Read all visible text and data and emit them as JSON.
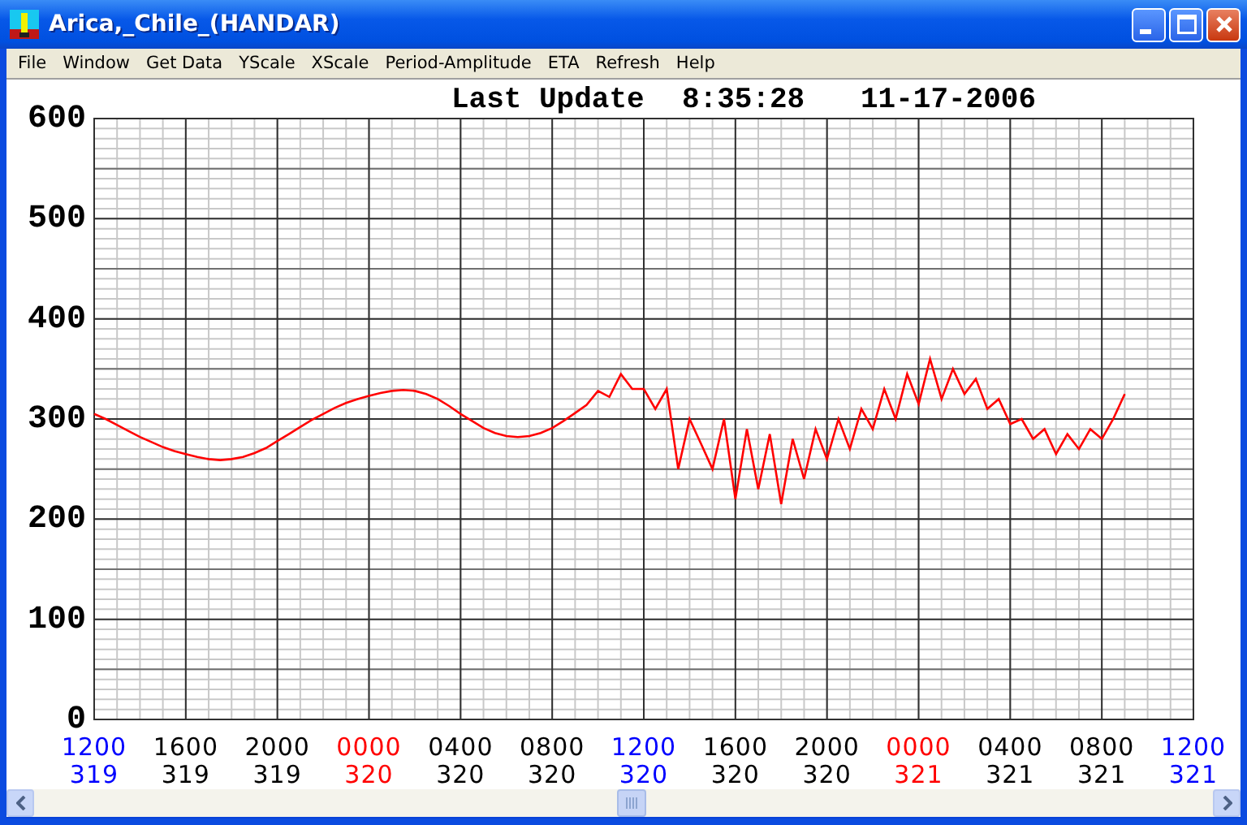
{
  "window": {
    "title": "Arica,_Chile_(HANDAR)"
  },
  "menu": [
    "File",
    "Window",
    "Get Data",
    "YScale",
    "XScale",
    "Period-Amplitude",
    "ETA",
    "Refresh",
    "Help"
  ],
  "header": {
    "label": "Last Update",
    "time": "8:35:28",
    "date": "11-17-2006"
  },
  "chart_data": {
    "type": "line",
    "grid": true,
    "ylim": [
      0,
      600
    ],
    "yticks": [
      0,
      100,
      200,
      300,
      400,
      500,
      600
    ],
    "categories": [
      "1200",
      null,
      null,
      null,
      null,
      null,
      null,
      null,
      "1600",
      null,
      null,
      null,
      null,
      null,
      null,
      null,
      "2000",
      null,
      null,
      null,
      null,
      null,
      null,
      null,
      "0000",
      null,
      null,
      null,
      null,
      null,
      null,
      null,
      "0400",
      null,
      null,
      null,
      null,
      null,
      null,
      null,
      "0800",
      null,
      null,
      null,
      null,
      null,
      null,
      null,
      "1200",
      null,
      null,
      null,
      null,
      null,
      null,
      null,
      "1600",
      null,
      null,
      null,
      null,
      null,
      null,
      null,
      "2000",
      null,
      null,
      null,
      null,
      null,
      null,
      null,
      "0000",
      null,
      null,
      null,
      null,
      null,
      null,
      null,
      "0400",
      null,
      null,
      null,
      null,
      null,
      null,
      null,
      "0800",
      null,
      null,
      null,
      null,
      null,
      null,
      null,
      "1200"
    ],
    "series": [
      {
        "color": "#ff0000",
        "values": [
          305,
          300,
          294,
          288,
          282,
          277,
          272,
          268,
          265,
          262,
          260,
          259,
          260,
          262,
          266,
          271,
          278,
          285,
          292,
          299,
          305,
          311,
          316,
          320,
          323,
          326,
          328,
          329,
          328,
          325,
          320,
          313,
          305,
          298,
          291,
          286,
          283,
          282,
          283,
          286,
          291,
          298,
          306,
          314,
          328,
          322,
          345,
          330,
          330,
          310,
          330,
          250,
          300,
          275,
          250,
          300,
          220,
          290,
          230,
          285,
          215,
          280,
          240,
          290,
          260,
          300,
          270,
          310,
          290,
          330,
          300,
          345,
          315,
          360,
          320,
          350,
          325,
          340,
          310,
          320,
          295,
          300,
          280,
          290,
          265,
          285,
          270,
          290,
          280,
          300,
          325,
          null,
          null,
          null,
          null,
          null,
          null
        ]
      }
    ]
  },
  "x_axis_days": [
    {
      "day": "319",
      "color": "#0000ff"
    },
    {
      "day": "319",
      "color": "#000000"
    },
    {
      "day": "319",
      "color": "#000000"
    },
    {
      "day": "320",
      "color": "#ff0000"
    },
    {
      "day": "320",
      "color": "#000000"
    },
    {
      "day": "320",
      "color": "#000000"
    },
    {
      "day": "320",
      "color": "#0000ff"
    },
    {
      "day": "320",
      "color": "#000000"
    },
    {
      "day": "320",
      "color": "#000000"
    },
    {
      "day": "321",
      "color": "#ff0000"
    },
    {
      "day": "321",
      "color": "#000000"
    },
    {
      "day": "321",
      "color": "#000000"
    },
    {
      "day": "321",
      "color": "#0000ff"
    }
  ]
}
